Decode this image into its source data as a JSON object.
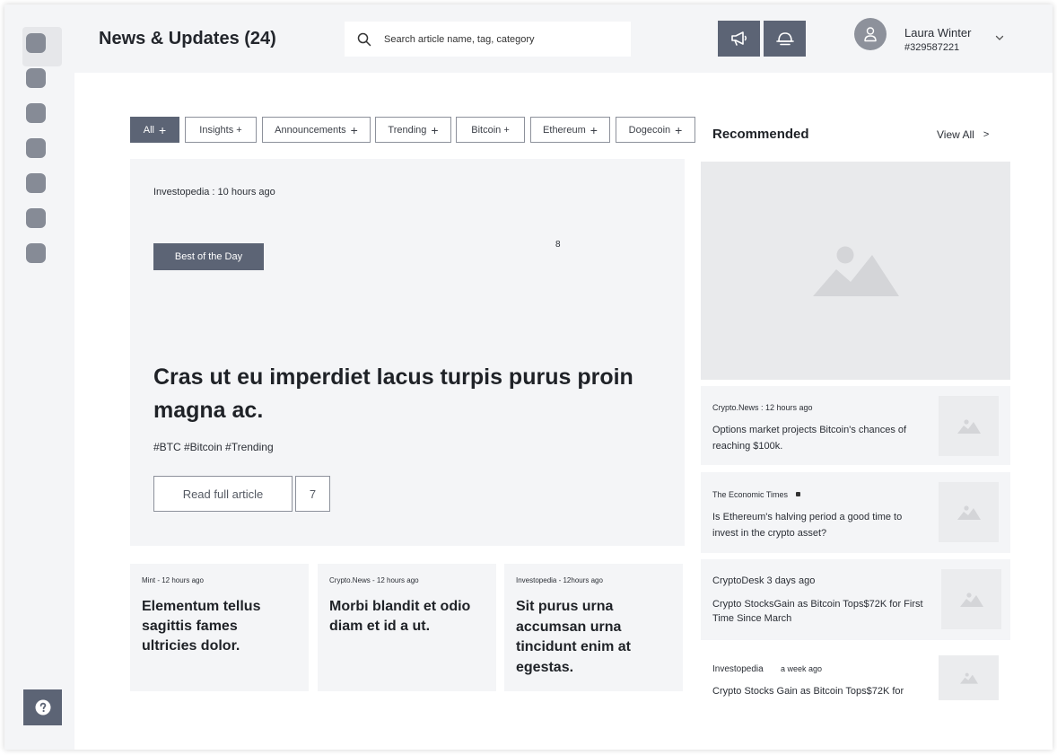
{
  "header": {
    "title": "News & Updates (24)",
    "search_placeholder": "Search article name, tag, category",
    "user": {
      "name": "Laura Winter",
      "id": "#329587221"
    }
  },
  "filters": [
    {
      "label": "All",
      "active": true
    },
    {
      "label": "Insights +",
      "active": false
    },
    {
      "label": "Announcements",
      "active": false
    },
    {
      "label": "Trending",
      "active": false
    },
    {
      "label": "Bitcoin +",
      "active": false
    },
    {
      "label": "Ethereum",
      "active": false
    },
    {
      "label": "Dogecoin",
      "active": false
    }
  ],
  "featured": {
    "source": "Investopedia : 10 hours ago",
    "badge": "Best of the Day",
    "count": "8",
    "title": "Cras ut eu imperdiet lacus turpis purus proin magna ac.",
    "tags": "#BTC #Bitcoin #Trending",
    "read_label": "Read full article",
    "comments": "7"
  },
  "cards": [
    {
      "source": "Mint - 12 hours ago",
      "title": "Elementum tellus sagittis fames ultricies dolor."
    },
    {
      "source": "Crypto.News - 12 hours ago",
      "title": "Morbi blandit et odio diam et id a ut."
    },
    {
      "source": "Investopedia - 12hours ago",
      "title": "Sit purus urna accumsan urna tincidunt enim at egestas."
    }
  ],
  "recommended": {
    "heading": "Recommended",
    "view_all": "View All",
    "view_all_arrow": ">",
    "items": [
      {
        "source": "Crypto.News : 12 hours ago",
        "title": "Options market projects Bitcoin's chances of reaching $100k."
      },
      {
        "source": "The Economic Times",
        "title": "Is Ethereum's halving period a good time to invest in the crypto asset?"
      },
      {
        "source": "CryptoDesk  3 days ago",
        "title": "Crypto StocksGain as Bitcoin Tops$72K for First Time Since March"
      },
      {
        "source": "Investopedia",
        "source_time": "a week ago",
        "title": "Crypto Stocks Gain as Bitcoin Tops$72K for"
      }
    ]
  },
  "colors": {
    "accent": "#5c6475",
    "panel": "#f4f5f7",
    "icon_gray": "#868b96",
    "placeholder": "#d4d5d8"
  }
}
